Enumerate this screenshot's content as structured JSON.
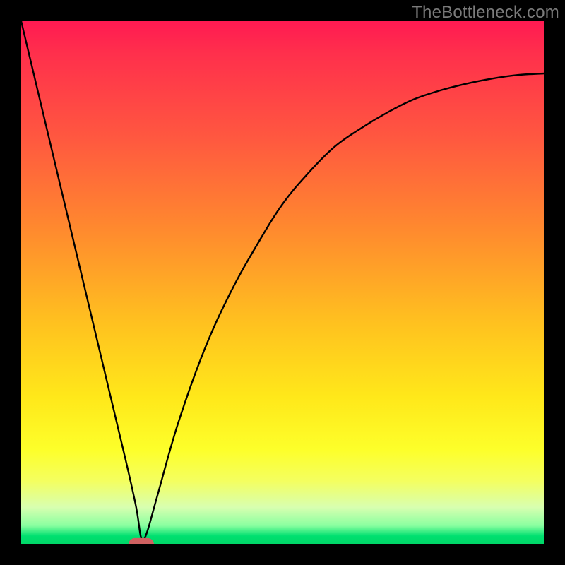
{
  "watermark": "TheBottleneck.com",
  "chart_data": {
    "type": "line",
    "title": "",
    "xlabel": "",
    "ylabel": "",
    "xlim": [
      0,
      100
    ],
    "ylim": [
      0,
      100
    ],
    "series": [
      {
        "name": "curve",
        "x": [
          0,
          5,
          10,
          15,
          20,
          22,
          23,
          24,
          26,
          30,
          35,
          40,
          45,
          50,
          55,
          60,
          65,
          70,
          75,
          80,
          85,
          90,
          95,
          100
        ],
        "y": [
          100,
          79,
          58,
          37,
          16,
          7,
          1,
          2,
          9,
          23,
          37,
          48,
          57,
          65,
          71,
          76,
          79.5,
          82.5,
          85,
          86.7,
          88,
          89,
          89.7,
          90
        ]
      }
    ],
    "marker": {
      "x": 23,
      "y": 0,
      "color": "#cf6161"
    },
    "gradient_stops": [
      {
        "pct": 0,
        "color": "#ff1a52"
      },
      {
        "pct": 22,
        "color": "#ff5740"
      },
      {
        "pct": 40,
        "color": "#ff8a2e"
      },
      {
        "pct": 58,
        "color": "#ffc21f"
      },
      {
        "pct": 82,
        "color": "#fdff2a"
      },
      {
        "pct": 95,
        "color": "#a7ffb0"
      },
      {
        "pct": 100,
        "color": "#00d868"
      }
    ]
  }
}
